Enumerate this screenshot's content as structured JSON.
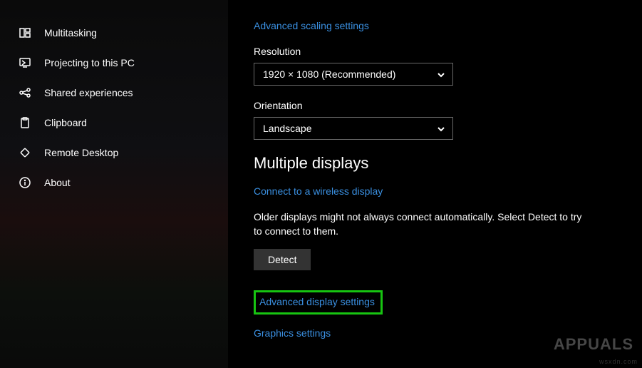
{
  "sidebar": {
    "items": [
      {
        "label": "Multitasking",
        "icon": "multitasking"
      },
      {
        "label": "Projecting to this PC",
        "icon": "projecting"
      },
      {
        "label": "Shared experiences",
        "icon": "shared"
      },
      {
        "label": "Clipboard",
        "icon": "clipboard"
      },
      {
        "label": "Remote Desktop",
        "icon": "remote"
      },
      {
        "label": "About",
        "icon": "about"
      }
    ]
  },
  "main": {
    "advanced_scaling_link": "Advanced scaling settings",
    "resolution": {
      "label": "Resolution",
      "value": "1920 × 1080 (Recommended)"
    },
    "orientation": {
      "label": "Orientation",
      "value": "Landscape"
    },
    "multiple_displays": {
      "heading": "Multiple displays",
      "wireless_link": "Connect to a wireless display",
      "body_text": "Older displays might not always connect automatically. Select Detect to try to connect to them.",
      "detect_button": "Detect"
    },
    "advanced_display_link": "Advanced display settings",
    "graphics_link": "Graphics settings"
  },
  "watermark": {
    "brand": "APPUALS",
    "site": "wsxdn.com"
  }
}
